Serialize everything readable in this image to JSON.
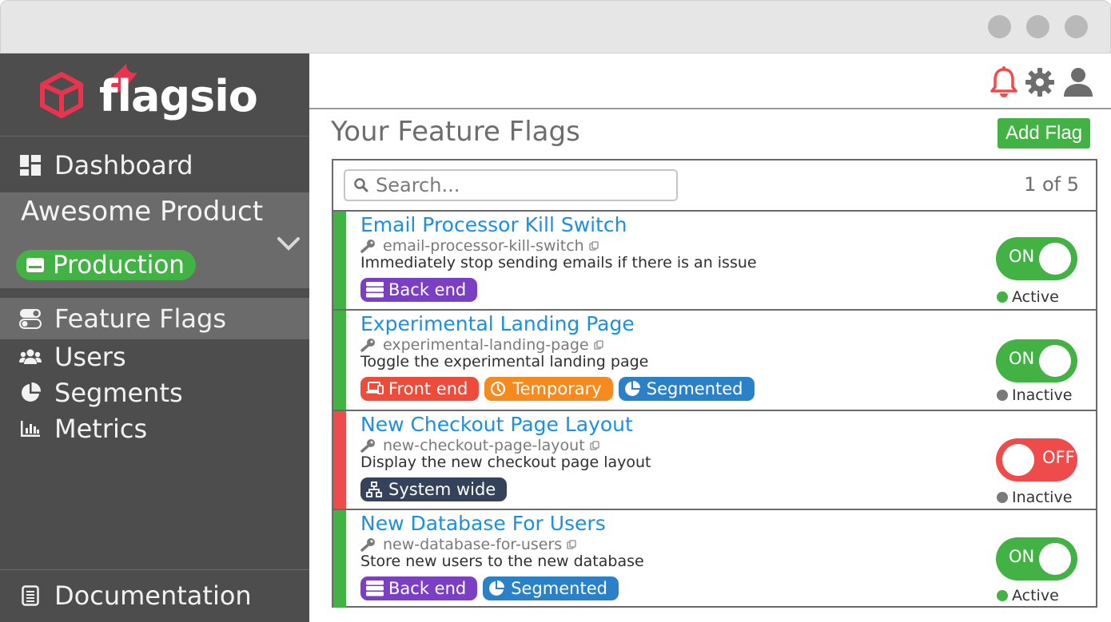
{
  "brand": {
    "name": "flagsio"
  },
  "sidebar": {
    "dashboard": "Dashboard",
    "project": "Awesome Product",
    "environment": "Production",
    "items": [
      {
        "label": "Feature Flags",
        "icon": "toggle-icon"
      },
      {
        "label": "Users",
        "icon": "users-icon"
      },
      {
        "label": "Segments",
        "icon": "pie-icon"
      },
      {
        "label": "Metrics",
        "icon": "bar-chart-icon"
      }
    ],
    "documentation": "Documentation"
  },
  "header": {
    "icons": [
      "bell-icon",
      "gear-icon",
      "user-icon"
    ]
  },
  "main": {
    "title": "Your Feature Flags",
    "add_label": "Add Flag",
    "search_placeholder": "Search...",
    "pager": "1 of 5"
  },
  "flags": [
    {
      "name": "Email Processor Kill Switch",
      "key": "email-processor-kill-switch",
      "description": "Immediately stop sending emails if there is an issue",
      "tags": [
        {
          "label": "Back end",
          "color": "#7b3fc4"
        }
      ],
      "toggle": "ON",
      "enabled": true,
      "status": "Active",
      "status_color": "#43b244",
      "stripe_color": "#43b244"
    },
    {
      "name": "Experimental Landing Page",
      "key": "experimental-landing-page",
      "description": "Toggle the experimental landing page",
      "tags": [
        {
          "label": "Front end",
          "color": "#ef4b3a"
        },
        {
          "label": "Temporary",
          "color": "#f58a1f"
        },
        {
          "label": "Segmented",
          "color": "#2b81c8"
        }
      ],
      "toggle": "ON",
      "enabled": true,
      "status": "Inactive",
      "status_color": "#7a7a7a",
      "stripe_color": "#43b244"
    },
    {
      "name": "New Checkout Page Layout",
      "key": "new-checkout-page-layout",
      "description": "Display the new checkout page layout",
      "tags": [
        {
          "label": "System wide",
          "color": "#34425a"
        }
      ],
      "toggle": "OFF",
      "enabled": false,
      "status": "Inactive",
      "status_color": "#7a7a7a",
      "stripe_color": "#ef4b4b"
    },
    {
      "name": "New Database For Users",
      "key": "new-database-for-users",
      "description": "Store new users to the new database",
      "tags": [
        {
          "label": "Back end",
          "color": "#7b3fc4"
        },
        {
          "label": "Segmented",
          "color": "#2b81c8"
        }
      ],
      "toggle": "ON",
      "enabled": true,
      "status": "Active",
      "status_color": "#43b244",
      "stripe_color": "#43b244"
    }
  ]
}
